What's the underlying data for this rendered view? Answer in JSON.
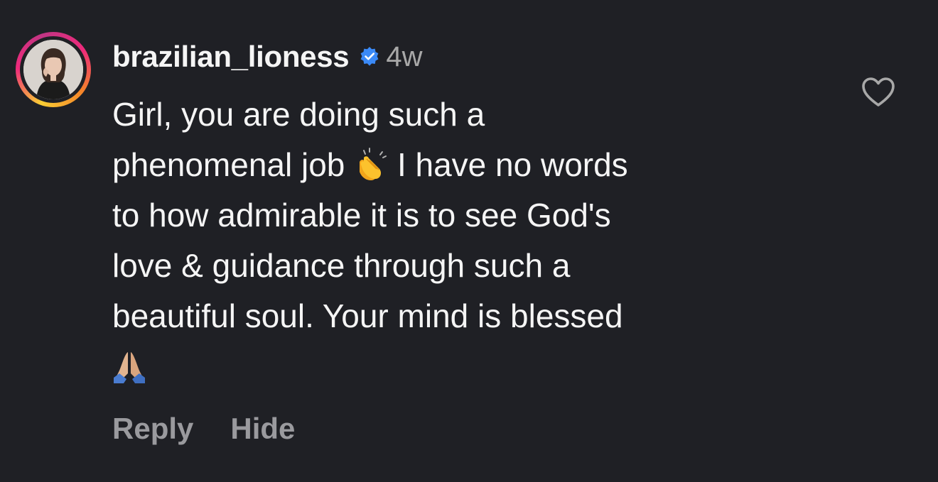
{
  "comment": {
    "username": "brazilian_lioness",
    "verified": true,
    "time_ago": "4w",
    "text_lines": [
      "Girl, you are doing such a",
      "phenomenal job",
      "I have no words",
      "to how admirable it is to see God's",
      "love & guidance through such a",
      "beautiful soul. Your mind is blessed"
    ],
    "emojis": {
      "clapping": "clapping-hands-emoji",
      "praying": "folded-hands-emoji"
    },
    "actions": {
      "reply_label": "Reply",
      "hide_label": "Hide"
    },
    "like_icon": "heart-outline-icon"
  },
  "colors": {
    "background": "#1f2025",
    "text": "#f5f5f5",
    "muted": "#a8a8a8",
    "action": "#9a9a9e",
    "verified_badge": "#3b8af7"
  }
}
